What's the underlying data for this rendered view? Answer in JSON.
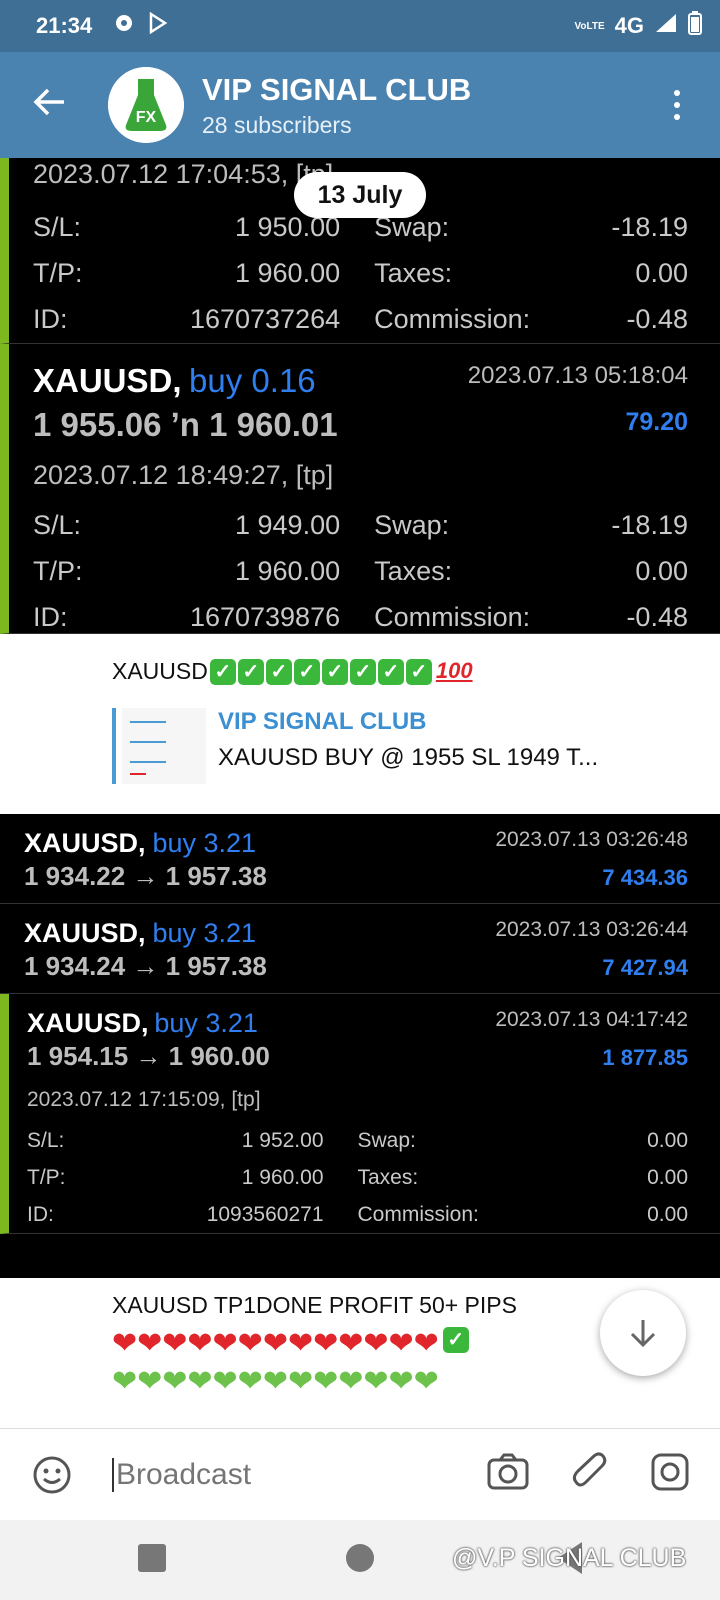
{
  "status": {
    "time": "21:34",
    "network": "4G",
    "lte": "VoLTE"
  },
  "header": {
    "channel": "VIP SIGNAL CLUB",
    "subscribers": "28 subscribers",
    "avatar_text": "FX"
  },
  "date_pill": "13 July",
  "trade1": {
    "open_time": "2023.07.12 17:04:53, [tp]",
    "sl_label": "S/L:",
    "sl": "1 950.00",
    "tp_label": "T/P:",
    "tp": "1 960.00",
    "id_label": "ID:",
    "id": "1670737264",
    "swap_label": "Swap:",
    "swap": "-18.19",
    "taxes_label": "Taxes:",
    "taxes": "0.00",
    "commission_label": "Commission:",
    "commission": "-0.48"
  },
  "trade2": {
    "symbol": "XAUUSD,",
    "side": "buy 0.16",
    "close_time": "2023.07.13 05:18:04",
    "prices": "1 955.06 ʼn  1 960.01",
    "profit": "79.20",
    "open_time": "2023.07.12 18:49:27, [tp]",
    "sl_label": "S/L:",
    "sl": "1 949.00",
    "tp_label": "T/P:",
    "tp": "1 960.00",
    "id_label": "ID:",
    "id": "1670739876",
    "swap_label": "Swap:",
    "swap": "-18.19",
    "taxes_label": "Taxes:",
    "taxes": "0.00",
    "commission_label": "Commission:",
    "commission": "-0.48"
  },
  "message1": {
    "text": "XAUUSD",
    "checks": 8,
    "hundred": "100",
    "reply_title": "VIP SIGNAL CLUB",
    "reply_body": "XAUUSD BUY @ 1955 SL 1949 T..."
  },
  "trade3": {
    "symbol": "XAUUSD,",
    "side": "buy 3.21",
    "close_time": "2023.07.13 03:26:48",
    "prices": "1 934.22 → 1 957.38",
    "profit": "7 434.36"
  },
  "trade4": {
    "symbol": "XAUUSD,",
    "side": "buy 3.21",
    "close_time": "2023.07.13 03:26:44",
    "prices": "1 934.24 → 1 957.38",
    "profit": "7 427.94"
  },
  "trade5": {
    "symbol": "XAUUSD,",
    "side": "buy 3.21",
    "close_time": "2023.07.13 04:17:42",
    "prices": "1 954.15 → 1 960.00",
    "profit": "1 877.85",
    "open_time": "2023.07.12 17:15:09, [tp]",
    "sl_label": "S/L:",
    "sl": "1 952.00",
    "tp_label": "T/P:",
    "tp": "1 960.00",
    "id_label": "ID:",
    "id": "1093560271",
    "swap_label": "Swap:",
    "swap": "0.00",
    "taxes_label": "Taxes:",
    "taxes": "0.00",
    "commission_label": "Commission:",
    "commission": "0.00"
  },
  "message2": {
    "text": "XAUUSD TP1DONE PROFIT 50+ PIPS"
  },
  "composer": {
    "placeholder": "Broadcast"
  },
  "watermark": "@V.P SIGNAL CLUB",
  "colors": {
    "header": "#4a82b0",
    "accent": "#2f7ff0",
    "bar": "#7db81f"
  }
}
